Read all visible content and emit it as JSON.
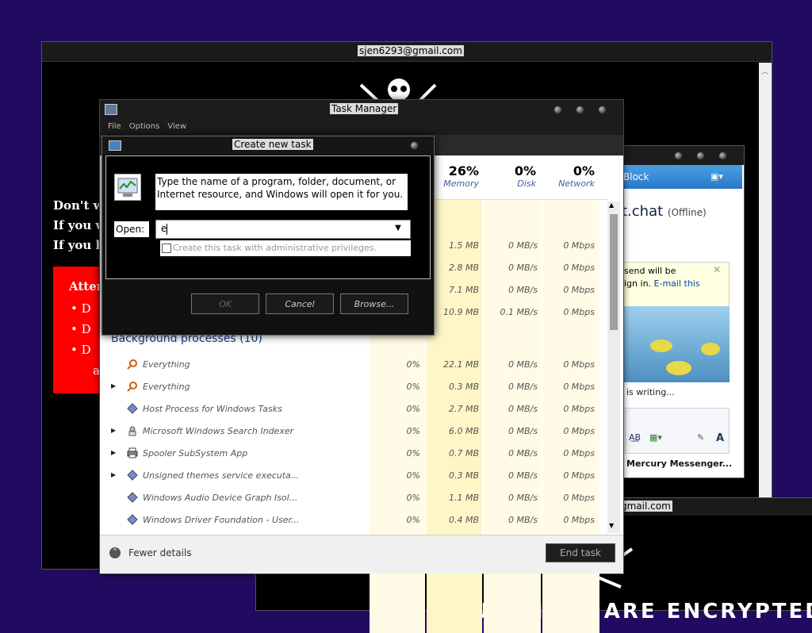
{
  "ransom_window": {
    "title": "sjen6293@gmail.com",
    "lines": [
      "Don't wo",
      "If you w",
      "If you ha"
    ],
    "red_box": {
      "heading": "Atten",
      "bullets": [
        "D",
        "D",
        "D"
      ],
      "last_fragment": "a"
    }
  },
  "task_manager": {
    "title": "Task Manager",
    "menu": [
      "File",
      "Options",
      "View"
    ],
    "columns": [
      {
        "value": "26%",
        "label": "Memory"
      },
      {
        "value": "0%",
        "label": "Disk"
      },
      {
        "value": "0%",
        "label": "Network"
      }
    ],
    "app_rows": [
      {
        "memory": "1.5 MB",
        "disk": "0 MB/s",
        "network": "0 Mbps"
      },
      {
        "memory": "2.8 MB",
        "disk": "0 MB/s",
        "network": "0 Mbps"
      },
      {
        "memory": "7.1 MB",
        "disk": "0 MB/s",
        "network": "0 Mbps"
      },
      {
        "memory": "10.9 MB",
        "disk": "0.1 MB/s",
        "network": "0 Mbps"
      }
    ],
    "group_label": "Background processes (10)",
    "processes": [
      {
        "name": "Everything",
        "cpu": "0%",
        "memory": "22.1 MB",
        "disk": "0 MB/s",
        "network": "0 Mbps",
        "icon": "search-magnifier-icon",
        "expandable": false
      },
      {
        "name": "Everything",
        "cpu": "0%",
        "memory": "0.3 MB",
        "disk": "0 MB/s",
        "network": "0 Mbps",
        "icon": "search-magnifier-icon",
        "expandable": true
      },
      {
        "name": "Host Process for Windows Tasks",
        "cpu": "0%",
        "memory": "2.7 MB",
        "disk": "0 MB/s",
        "network": "0 Mbps",
        "icon": "process-diamond-icon",
        "expandable": false
      },
      {
        "name": "Microsoft Windows Search Indexer",
        "cpu": "0%",
        "memory": "6.0 MB",
        "disk": "0 MB/s",
        "network": "0 Mbps",
        "icon": "search-indexer-icon",
        "expandable": true
      },
      {
        "name": "Spooler SubSystem App",
        "cpu": "0%",
        "memory": "0.7 MB",
        "disk": "0 MB/s",
        "network": "0 Mbps",
        "icon": "printer-icon",
        "expandable": true
      },
      {
        "name": "Unsigned themes service executa...",
        "cpu": "0%",
        "memory": "0.3 MB",
        "disk": "0 MB/s",
        "network": "0 Mbps",
        "icon": "process-diamond-icon",
        "expandable": true
      },
      {
        "name": "Windows Audio Device Graph Isol...",
        "cpu": "0%",
        "memory": "1.1 MB",
        "disk": "0 MB/s",
        "network": "0 Mbps",
        "icon": "process-diamond-icon",
        "expandable": false
      },
      {
        "name": "Windows Driver Foundation - User...",
        "cpu": "0%",
        "memory": "0.4 MB",
        "disk": "0 MB/s",
        "network": "0 Mbps",
        "icon": "process-diamond-icon",
        "expandable": false
      }
    ],
    "fewer_details": "Fewer details",
    "end_task": "End task"
  },
  "create_task_dialog": {
    "title": "Create new task",
    "description": "Type the name of a program, folder, document, or Internet resource, and Windows will open it for you.",
    "open_label": "Open:",
    "open_value": "e",
    "admin_checkbox_label": "Create this task with administrative privileges.",
    "ok": "OK",
    "cancel": "Cancel",
    "browse": "Browse..."
  },
  "messenger": {
    "block_label": "Block",
    "chat_title": "t.chat",
    "status": "(Offline)",
    "notice_line1": "send will be",
    "notice_line2": "ign in.",
    "notice_link": "E-mail this",
    "typing": "is writing...",
    "brand": "Mercury Messenger..."
  },
  "ransom_window_2": {
    "title_fragment": "gmail.com",
    "banner": "YOUR FILES ARE ENCRYPTED"
  },
  "colors": {
    "ransom_red": "#ff0000",
    "desktop": "#200b60",
    "memory_column": "#fff6c8"
  }
}
